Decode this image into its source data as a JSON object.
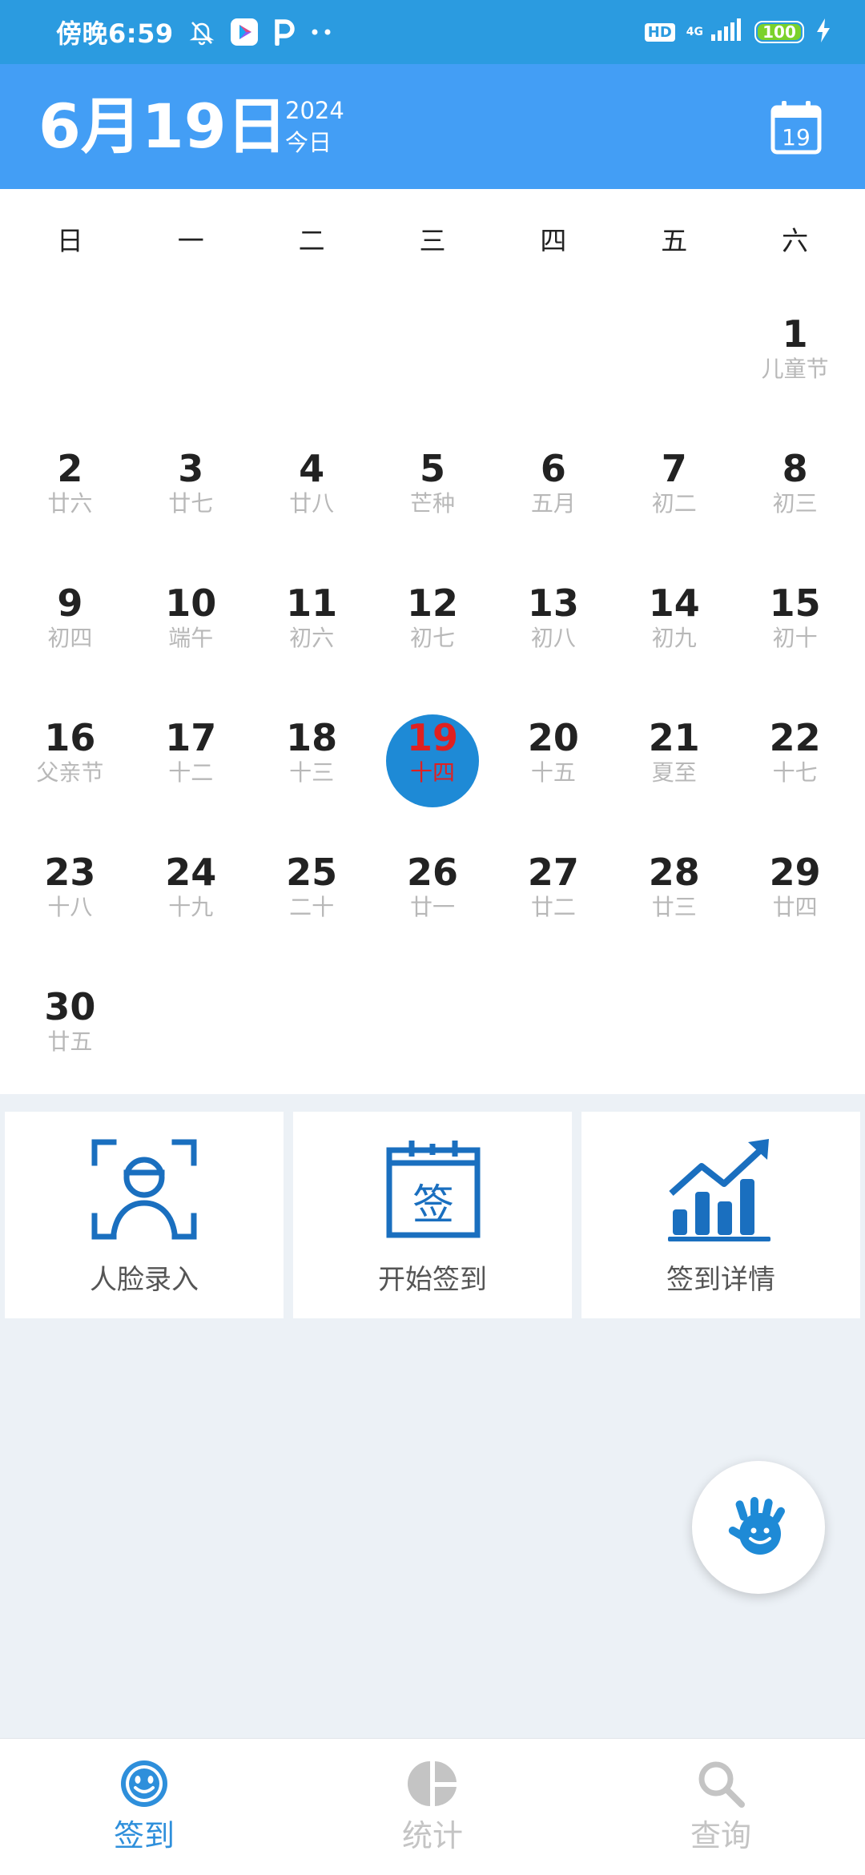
{
  "status_bar": {
    "time": "傍晚6:59",
    "hd": "HD",
    "network": "4G",
    "battery": "100",
    "icons": [
      "mute-bell-icon",
      "play-store-icon",
      "p-app-icon",
      "more-dots-icon",
      "signal-icon",
      "charging-bolt-icon"
    ]
  },
  "header": {
    "date": "6月19日",
    "year": "2024",
    "today_label": "今日",
    "calendar_button_day": "19"
  },
  "calendar": {
    "weekdays": [
      "日",
      "一",
      "二",
      "三",
      "四",
      "五",
      "六"
    ],
    "days": [
      {
        "day": "",
        "lunar": ""
      },
      {
        "day": "",
        "lunar": ""
      },
      {
        "day": "",
        "lunar": ""
      },
      {
        "day": "",
        "lunar": ""
      },
      {
        "day": "",
        "lunar": ""
      },
      {
        "day": "",
        "lunar": ""
      },
      {
        "day": "1",
        "lunar": "儿童节"
      },
      {
        "day": "2",
        "lunar": "廿六"
      },
      {
        "day": "3",
        "lunar": "廿七"
      },
      {
        "day": "4",
        "lunar": "廿八"
      },
      {
        "day": "5",
        "lunar": "芒种"
      },
      {
        "day": "6",
        "lunar": "五月"
      },
      {
        "day": "7",
        "lunar": "初二"
      },
      {
        "day": "8",
        "lunar": "初三"
      },
      {
        "day": "9",
        "lunar": "初四"
      },
      {
        "day": "10",
        "lunar": "端午"
      },
      {
        "day": "11",
        "lunar": "初六"
      },
      {
        "day": "12",
        "lunar": "初七"
      },
      {
        "day": "13",
        "lunar": "初八"
      },
      {
        "day": "14",
        "lunar": "初九"
      },
      {
        "day": "15",
        "lunar": "初十"
      },
      {
        "day": "16",
        "lunar": "父亲节"
      },
      {
        "day": "17",
        "lunar": "十二"
      },
      {
        "day": "18",
        "lunar": "十三"
      },
      {
        "day": "19",
        "lunar": "十四",
        "selected": true
      },
      {
        "day": "20",
        "lunar": "十五"
      },
      {
        "day": "21",
        "lunar": "夏至"
      },
      {
        "day": "22",
        "lunar": "十七"
      },
      {
        "day": "23",
        "lunar": "十八"
      },
      {
        "day": "24",
        "lunar": "十九"
      },
      {
        "day": "25",
        "lunar": "二十"
      },
      {
        "day": "26",
        "lunar": "廿一"
      },
      {
        "day": "27",
        "lunar": "廿二"
      },
      {
        "day": "28",
        "lunar": "廿三"
      },
      {
        "day": "29",
        "lunar": "廿四"
      },
      {
        "day": "30",
        "lunar": "廿五"
      }
    ]
  },
  "actions": [
    {
      "label": "人脸录入",
      "icon": "face-scan-icon"
    },
    {
      "label": "开始签到",
      "icon": "calendar-sign-icon",
      "icon_text": "签"
    },
    {
      "label": "签到详情",
      "icon": "bar-chart-trend-icon"
    }
  ],
  "fab": {
    "icon": "smiling-hand-icon"
  },
  "bottom_nav": [
    {
      "label": "签到",
      "icon": "smiley-icon",
      "active": true
    },
    {
      "label": "统计",
      "icon": "pie-chart-icon",
      "active": false
    },
    {
      "label": "查询",
      "icon": "search-icon",
      "active": false
    }
  ],
  "colors": {
    "status_bar": "#2B9BE0",
    "header": "#439EF5",
    "accent_blue": "#1E8AD6",
    "icon_blue": "#1A6FBF",
    "selected_text": "#E02020",
    "page_bg": "#ECF1F6"
  }
}
